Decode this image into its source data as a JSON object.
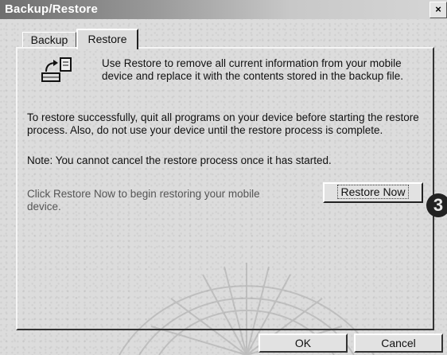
{
  "window": {
    "title": "Backup/Restore",
    "close_label": "×"
  },
  "tabs": [
    {
      "label": "Backup",
      "selected": false
    },
    {
      "label": "Restore",
      "selected": true
    }
  ],
  "restore_panel": {
    "icon": "restore-icon",
    "intro": "Use Restore to remove all current information from your mobile device and replace it with the contents stored in the backup file.",
    "instructions": "To restore successfully, quit all programs on your device before starting the restore process. Also, do not use your device until the restore process is complete.",
    "note": "Note: You cannot cancel the restore process once it has started.",
    "prompt": "Click Restore Now to begin restoring your mobile device.",
    "restore_now_label": "Restore Now"
  },
  "callout_number": "3",
  "footer": {
    "ok_label": "OK",
    "cancel_label": "Cancel"
  }
}
